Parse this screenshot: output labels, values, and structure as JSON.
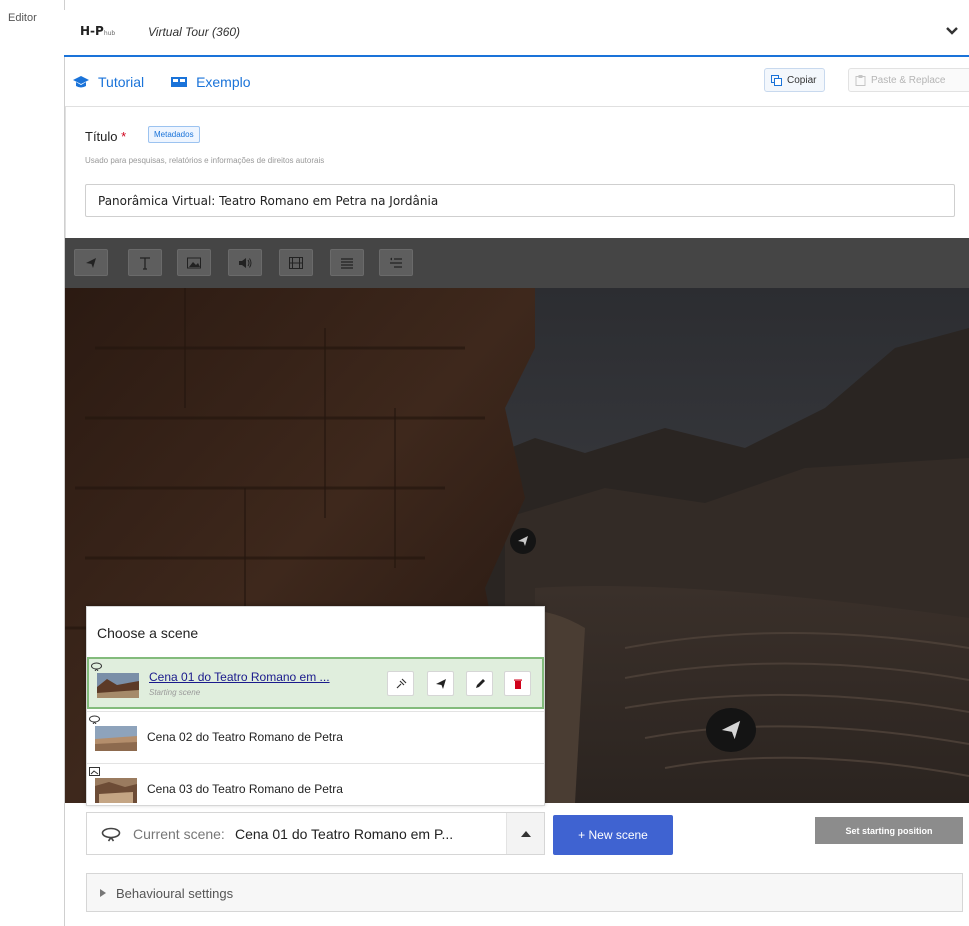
{
  "sidebar": {
    "label": "Editor"
  },
  "library": {
    "logo": "H-P",
    "logo_sub": "hub",
    "content_type": "Virtual Tour (360)"
  },
  "links": {
    "tutorial": "Tutorial",
    "example": "Exemplo"
  },
  "clipboard": {
    "copy": "Copiar",
    "paste": "Paste & Replace"
  },
  "title_field": {
    "label": "Título",
    "required_mark": "*",
    "metadata_tag": "Metadados",
    "description": "Usado para pesquisas, relatórios e informações de direitos autorais",
    "value": "Panorâmica Virtual: Teatro Romano em Petra na Jordânia"
  },
  "toolbar": {
    "tools": [
      "go-to-scene",
      "text",
      "image",
      "audio",
      "video",
      "summary",
      "single-choice-set"
    ]
  },
  "scene_chooser": {
    "title": "Choose a scene",
    "scenes": [
      {
        "label": "Cena 01 do Teatro Romano em ...",
        "sublabel": "Starting scene",
        "active": true,
        "type": "360"
      },
      {
        "label": "Cena 02 do Teatro Romano de Petra",
        "active": false,
        "type": "360"
      },
      {
        "label": "Cena 03 do Teatro Romano de Petra",
        "active": false,
        "type": "static"
      }
    ]
  },
  "current_scene": {
    "label": "Current scene:",
    "name": "Cena 01 do Teatro Romano em P..."
  },
  "buttons": {
    "new_scene": "+ New scene",
    "set_starting_position": "Set starting position"
  },
  "behavioural": {
    "label": "Behavioural settings"
  },
  "colors": {
    "accent": "#1a73d9",
    "new_scene_button": "#3f63d1",
    "active_scene_bg": "#e0eedd",
    "active_scene_border": "#83bb7c",
    "delete_red": "#d0021b"
  }
}
